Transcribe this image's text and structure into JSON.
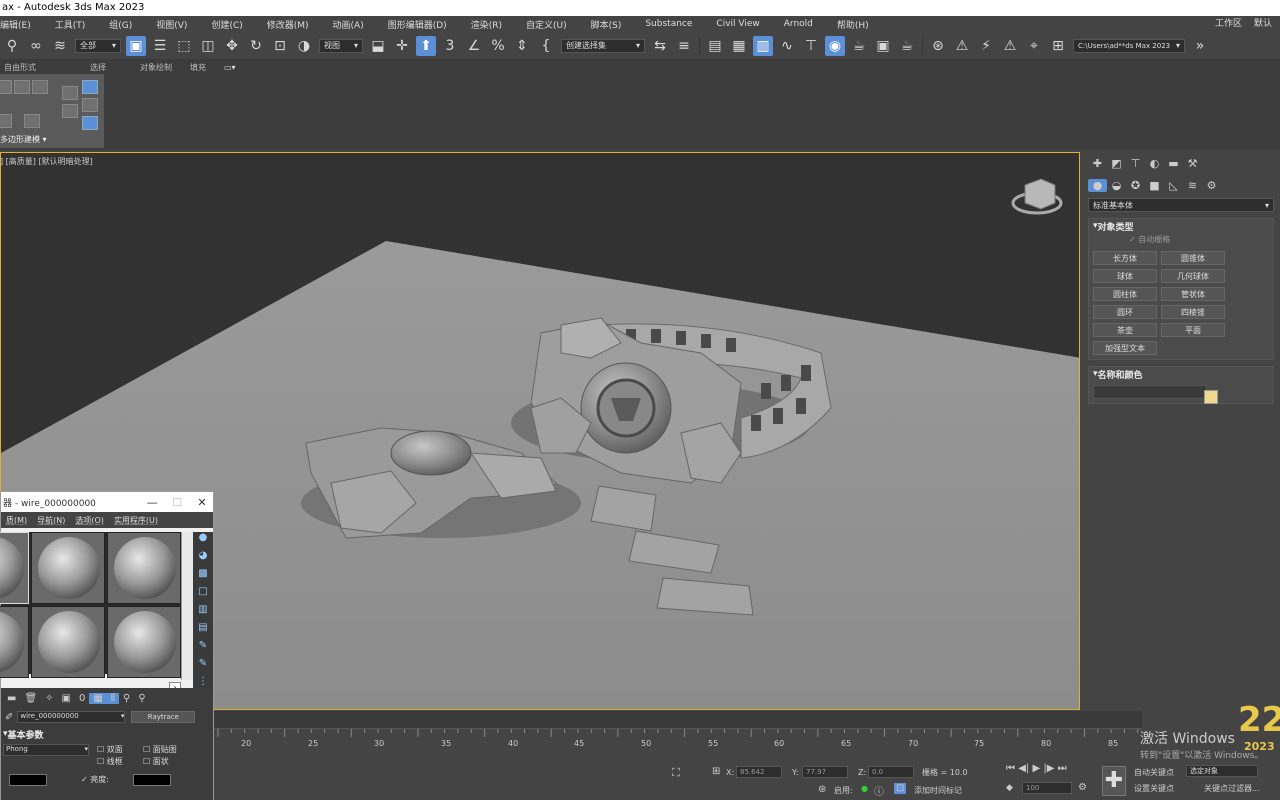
{
  "title": "ax - Autodesk 3ds Max 2023",
  "menu": [
    "编辑(E)",
    "工具(T)",
    "组(G)",
    "视图(V)",
    "创建(C)",
    "修改器(M)",
    "动画(A)",
    "图形编辑器(D)",
    "渲染(R)",
    "自定义(U)",
    "脚本(S)",
    "Substance",
    "Civil View",
    "Arnold",
    "帮助(H)"
  ],
  "menu_right": [
    "工作区",
    "默认"
  ],
  "toolbar": {
    "selection_filter": "全部",
    "ref_coord": "视图",
    "selection_set": "创建选择集",
    "path": "C:\\Users\\ad**ds Max 2023"
  },
  "ribbon_tabs": [
    "自由形式",
    "选择",
    "对象绘制",
    "填充"
  ],
  "ribbon_label": "多边形建模 ▾",
  "viewport_label": "] [高质量] [默认明暗处理]",
  "command_panel": {
    "category": "标准基本体",
    "object_type_header": "对象类型",
    "autogrid": "自动栅格",
    "buttons": [
      "长方体",
      "圆锥体",
      "球体",
      "几何球体",
      "圆柱体",
      "管状体",
      "圆环",
      "四棱锥",
      "茶壶",
      "平面",
      "加强型文本"
    ],
    "name_color_header": "名称和颜色",
    "swatch_color": "#f0d890"
  },
  "material_editor": {
    "title": "器 - wire_000000000",
    "menu": [
      "质(M)",
      "导航(N)",
      "选项(O)",
      "实用程序(U)"
    ],
    "material_name": "wire_000000000",
    "material_type": "Raytrace",
    "section": "基本参数",
    "shader": "Phong",
    "checks": [
      "双面",
      "线框",
      "面贴图",
      "面状"
    ],
    "brightness_label": "亮度:"
  },
  "timeline_ticks": [
    "20",
    "25",
    "30",
    "35",
    "40",
    "45",
    "50",
    "55",
    "60",
    "65",
    "70",
    "75",
    "80",
    "85"
  ],
  "status": {
    "x_label": "X:",
    "x_value": "85.642",
    "y_label": "Y:",
    "y_value": "77.97",
    "z_label": "Z:",
    "z_value": "0.0",
    "grid": "栅格 = 10.0",
    "enable": "启用:",
    "add_time_tag": "添加时间标记",
    "frame": "100",
    "auto_key": "自动关键点",
    "set_key": "设置关键点",
    "selected_object": "选定对象",
    "key_filter": "关键点过滤器..."
  },
  "watermark": {
    "line1": "激活 Windows",
    "line2": "转到\"设置\"以激活 Windows。"
  },
  "badge": {
    "year_big": "22",
    "year_small": "2023"
  }
}
